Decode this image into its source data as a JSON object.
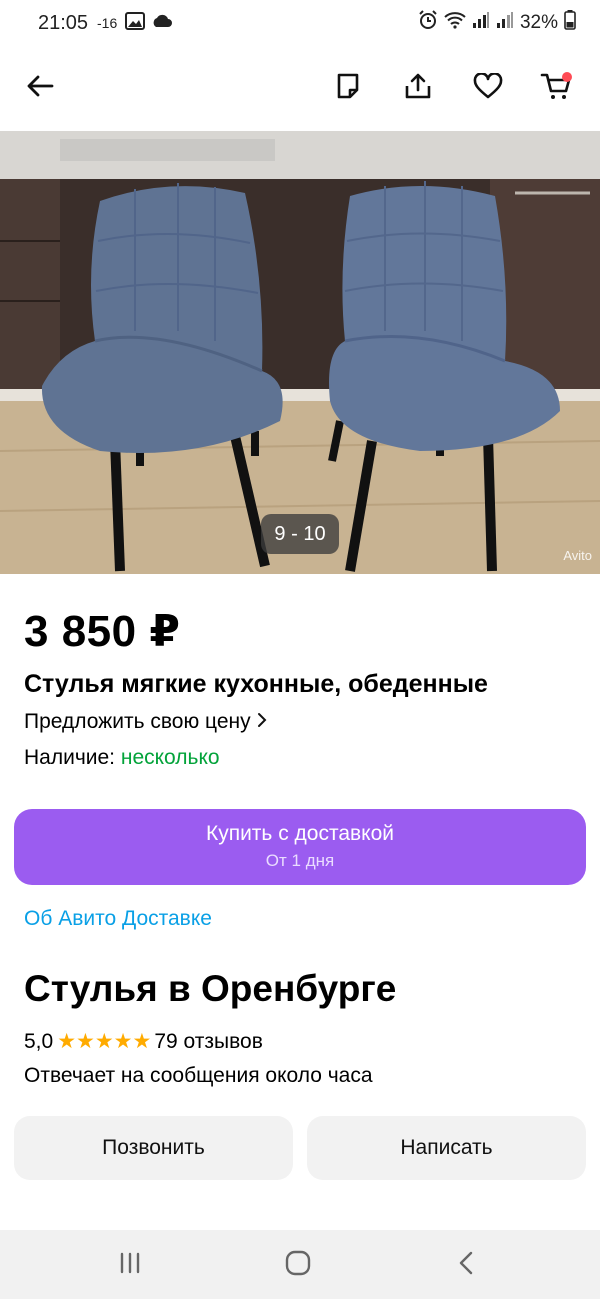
{
  "status_bar": {
    "time": "21:05",
    "temperature": "-16",
    "battery": "32%"
  },
  "header": {
    "back_icon": "arrow-left-icon",
    "note_icon": "note-icon",
    "share_icon": "share-icon",
    "favorite_icon": "heart-icon",
    "cart_icon": "cart-icon",
    "cart_badge_color": "#ff4b55"
  },
  "photo": {
    "counter": "9 - 10",
    "watermark": "Avito"
  },
  "listing": {
    "price": "3 850 ₽",
    "title": "Стулья мягкие кухонные, обеденные",
    "offer_price": "Предложить свою цену",
    "availability_label": "Наличие:",
    "availability_value": "несколько"
  },
  "buy": {
    "label": "Купить с доставкой",
    "sub": "От 1 дня",
    "color": "#9b5cf0"
  },
  "delivery_link": "Об Авито Доставке",
  "seller": {
    "name": "Стулья в Оренбурге",
    "rating": "5,0",
    "stars": "★★★★★",
    "reviews": "79 отзывов",
    "reply_note": "Отвечает на сообщения около часа"
  },
  "actions": {
    "call": "Позвонить",
    "write": "Написать"
  },
  "colors": {
    "accent": "#9b5cf0",
    "available": "#03a33a",
    "link": "#0aa0e6",
    "star": "#ffab00"
  }
}
